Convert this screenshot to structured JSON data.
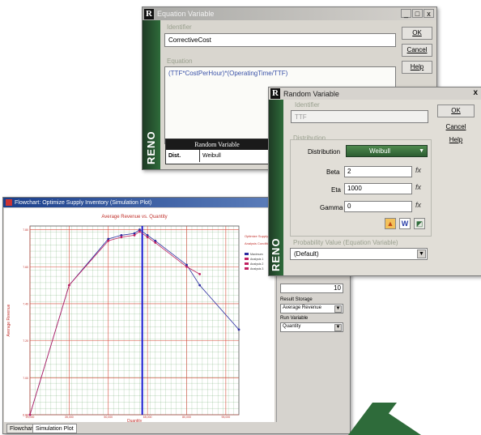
{
  "equation_window": {
    "title": "Equation Variable",
    "identifier_label": "Identifier",
    "identifier_value": "CorrectiveCost",
    "equation_label": "Equation",
    "equation_value": "(TTF*CostPerHour)*(OperatingTime/TTF)",
    "ok": "OK",
    "cancel": "Cancel",
    "help": "Help",
    "brand": "RENO",
    "table_title": "Random Variable",
    "table_header": "Dist.",
    "table_value": "Weibull",
    "controls": {
      "minimize": "_",
      "maximize": "□",
      "close": "x"
    }
  },
  "random_window": {
    "title": "Random Variable",
    "close": "x",
    "identifier_label": "Identifier",
    "identifier_value": "TTF",
    "distribution_group": "Distribution",
    "distribution_label": "Distribution",
    "distribution_value": "Weibull",
    "beta_label": "Beta",
    "beta_value": "2",
    "eta_label": "Eta",
    "eta_value": "1000",
    "gamma_label": "Gamma",
    "gamma_value": "0",
    "prob_label": "Probability Value (Equation Variable)",
    "prob_value": "(Default)",
    "ok": "OK",
    "cancel": "Cancel",
    "help": "Help",
    "brand": "RENO",
    "fx_icon": "fx",
    "icon_w": "W"
  },
  "flowchart_window": {
    "title": "Flowchart: Optimize Supply Inventory (Simulation Plot)",
    "tab_flowchart": "Flowchart",
    "tab_plot": "Simulation Plot",
    "panel": {
      "result_storage_label": "Result Storage",
      "result_storage_value": "Average Revenue",
      "run_variable_label": "Run Variable",
      "run_variable_value": "Quantity",
      "stepper_value": "10"
    }
  },
  "chart_data": {
    "type": "line",
    "title": "Average Revenue vs. Quantity",
    "xlabel": "Quantity",
    "ylabel": "Average Revenue",
    "xlim": [
      20000,
      100000
    ],
    "ylim": [
      6.8,
      7.82
    ],
    "x_ticks": [
      20000,
      35000,
      50000,
      65000,
      80000,
      95000
    ],
    "y_ticks": [
      6.8,
      7.0,
      7.2,
      7.4,
      7.6,
      7.8
    ],
    "x_tick_labels": [
      "20,000",
      "35,000",
      "50,000",
      "65,000",
      "80,000",
      "95,000"
    ],
    "y_tick_labels": [
      "6.80",
      "7.00",
      "7.20",
      "7.40",
      "7.60",
      "7.80"
    ],
    "side_labels": [
      "Optimize Supply",
      "Analysis Conditions"
    ],
    "legend": [
      "Maximum",
      "Analysis 1",
      "Analysis 2",
      "Analysis 3"
    ],
    "grid": true,
    "optimum_x": 63000,
    "colors": {
      "series": [
        "#2a2aa0",
        "#c02060"
      ],
      "optimum_line": "#1a1ad0",
      "grid": "#3b8a3b",
      "plot_bg": "#ffffff",
      "accent_green": "#2e6b3a"
    },
    "series": [
      {
        "name": "Maximum",
        "x": [
          20000,
          35000,
          50000,
          55000,
          60000,
          62000,
          65000,
          68000,
          80000,
          85000,
          100000
        ],
        "y": [
          6.8,
          7.5,
          7.75,
          7.77,
          7.78,
          7.8,
          7.77,
          7.74,
          7.61,
          7.5,
          7.26
        ]
      },
      {
        "name": "Analysis 1",
        "x": [
          20000,
          35000,
          50000,
          55000,
          60000,
          62000,
          65000,
          68000,
          80000,
          85000
        ],
        "y": [
          6.8,
          7.5,
          7.74,
          7.76,
          7.77,
          7.79,
          7.76,
          7.73,
          7.6,
          7.56
        ]
      }
    ]
  }
}
